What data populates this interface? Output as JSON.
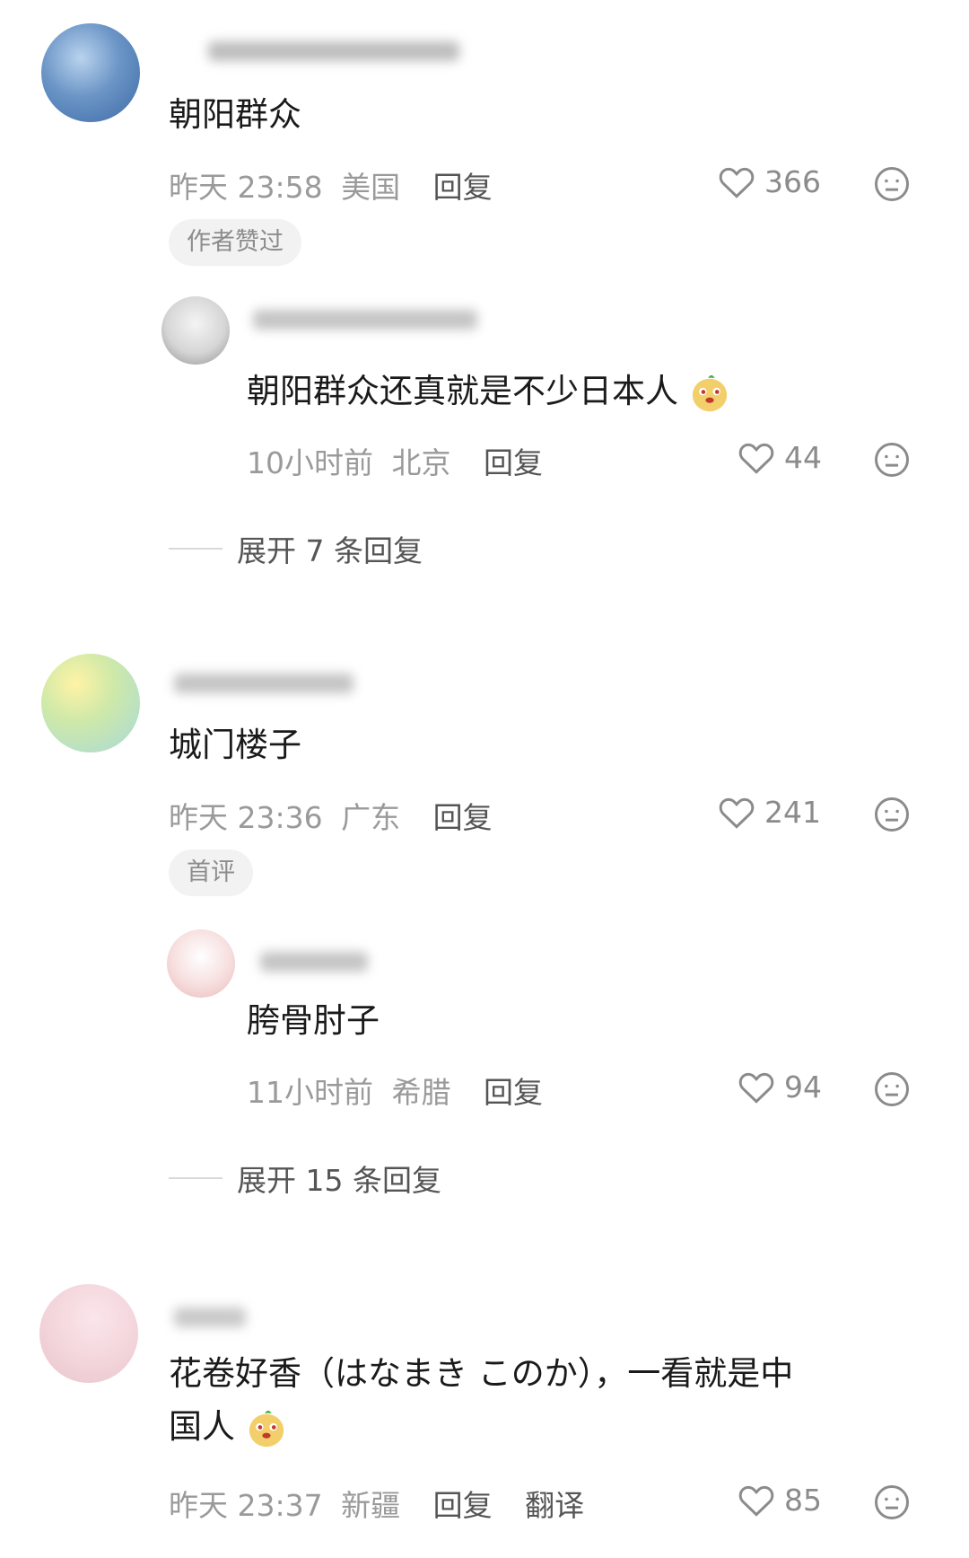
{
  "comments": [
    {
      "text": "朝阳群众",
      "time": "昨天 23:58",
      "location": "美国",
      "reply_label": "回复",
      "likes": "366",
      "tag": "作者赞过",
      "sub_reply": {
        "text": "朝阳群众还真就是不少日本人",
        "time": "10小时前",
        "location": "北京",
        "reply_label": "回复",
        "likes": "44"
      },
      "expand_label": "展开 7 条回复"
    },
    {
      "text": "城门楼子",
      "time": "昨天 23:36",
      "location": "广东",
      "reply_label": "回复",
      "likes": "241",
      "tag": "首评",
      "sub_reply": {
        "text": "胯骨肘子",
        "time": "11小时前",
        "location": "希腊",
        "reply_label": "回复",
        "likes": "94"
      },
      "expand_label": "展开 15 条回复"
    },
    {
      "text_line1": "花卷好香（はなまき このか），一看就是中",
      "text_line2": "国人",
      "time": "昨天 23:37",
      "location": "新疆",
      "reply_label": "回复",
      "translate_label": "翻译",
      "likes": "85"
    }
  ],
  "icons": {
    "like": "heart-outline-icon",
    "dislike": "meh-face-icon",
    "emoji": "doge-emoji-icon"
  },
  "colors": {
    "text_primary": "#1a1a1a",
    "text_meta": "#9a9a9a",
    "action": "#555555",
    "tag_bg": "#f2f2f2"
  }
}
